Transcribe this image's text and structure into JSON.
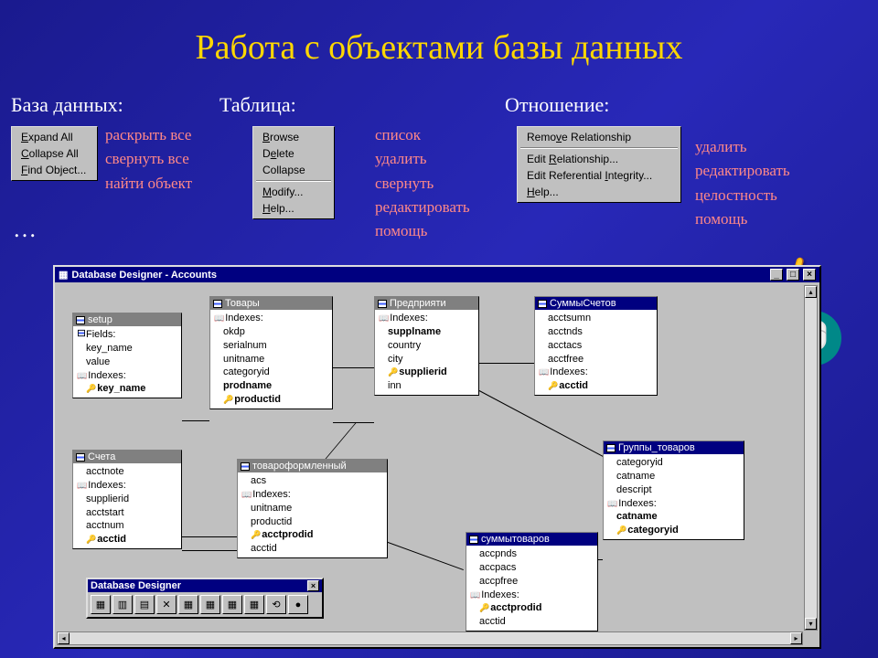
{
  "title": "Работа с объектами базы данных",
  "sections": {
    "db": "База данных:",
    "table": "Таблица:",
    "relation": "Отношение:"
  },
  "menu_db": {
    "items": [
      "Expand All",
      "Collapse All",
      "Find Object..."
    ]
  },
  "menu_db_ru": [
    "раскрыть все",
    "свернуть все",
    "найти объект"
  ],
  "ellipsis": "…",
  "menu_table": {
    "group1": [
      "Browse",
      "Delete",
      "Collapse"
    ],
    "group2": [
      "Modify...",
      "Help..."
    ]
  },
  "menu_table_ru": [
    "список",
    "удалить",
    "свернуть",
    "редактировать",
    "помощь"
  ],
  "menu_rel": {
    "group1": [
      "Remove Relationship"
    ],
    "group2": [
      "Edit Relationship...",
      "Edit Referential Integrity...",
      "Help..."
    ]
  },
  "menu_rel_ru": [
    "удалить",
    "редактировать",
    "целостность",
    "помощь"
  ],
  "designer": {
    "title": "Database Designer - Accounts",
    "toolbox_title": "Database Designer",
    "tables": {
      "setup": {
        "name": "setup",
        "sections": [
          {
            "h": "Fields:",
            "icon": "grid"
          },
          {
            "i": "key_name"
          },
          {
            "i": "value"
          },
          {
            "h": "Indexes:",
            "icon": "book"
          },
          {
            "pk": "key_name"
          }
        ]
      },
      "tovary": {
        "name": "Товары",
        "sections": [
          {
            "h": "Indexes:",
            "icon": "book"
          },
          {
            "i": "okdp"
          },
          {
            "i": "serialnum"
          },
          {
            "i": "unitname"
          },
          {
            "i": "categoryid"
          },
          {
            "b": "prodname"
          },
          {
            "pk": "productid"
          }
        ]
      },
      "predpr": {
        "name": "Предприяти",
        "sections": [
          {
            "h": "Indexes:",
            "icon": "book"
          },
          {
            "b": "supplname"
          },
          {
            "i": "country"
          },
          {
            "i": "city"
          },
          {
            "pk": "supplierid"
          },
          {
            "i": "inn"
          }
        ]
      },
      "summy": {
        "name": "СуммыСчетов",
        "sections": [
          {
            "i": "acctsumn"
          },
          {
            "i": "acctnds"
          },
          {
            "i": "acctacs"
          },
          {
            "i": "acctfree"
          },
          {
            "h": "Indexes:",
            "icon": "book"
          },
          {
            "pk": "acctid"
          }
        ]
      },
      "scheta": {
        "name": "Счета",
        "sections": [
          {
            "i": "acctnote"
          },
          {
            "h": "Indexes:",
            "icon": "book"
          },
          {
            "i": "supplierid"
          },
          {
            "i": "acctstart"
          },
          {
            "i": "acctnum"
          },
          {
            "pk": "acctid"
          }
        ]
      },
      "tovform": {
        "name": "товароформленный",
        "sections": [
          {
            "i": "acs"
          },
          {
            "h": "Indexes:",
            "icon": "book"
          },
          {
            "i": "unitname"
          },
          {
            "i": "productid"
          },
          {
            "pk": "acctprodid"
          },
          {
            "i": "acctid"
          }
        ]
      },
      "summytov": {
        "name": "суммытоваров",
        "sections": [
          {
            "i": "accpnds"
          },
          {
            "i": "accpacs"
          },
          {
            "i": "accpfree"
          },
          {
            "h": "Indexes:",
            "icon": "book"
          },
          {
            "pk": "acctprodid"
          },
          {
            "i": "acctid"
          }
        ]
      },
      "gruppy": {
        "name": "Группы_товаров",
        "sections": [
          {
            "i": "categoryid"
          },
          {
            "i": "catname"
          },
          {
            "i": "descript"
          },
          {
            "h": "Indexes:",
            "icon": "book"
          },
          {
            "b": "catname"
          },
          {
            "pk": "categoryid"
          }
        ]
      }
    }
  }
}
